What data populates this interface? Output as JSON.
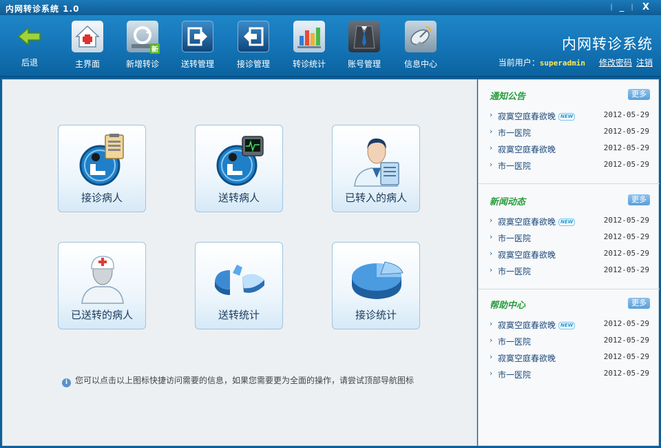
{
  "window": {
    "title": "内网转诊系统 1.0",
    "min": "_",
    "close": "X"
  },
  "nav": {
    "back": "后退",
    "items": [
      {
        "label": "主界面",
        "icon": "home-icon"
      },
      {
        "label": "新增转诊",
        "icon": "refresh-new-icon",
        "badge": "新"
      },
      {
        "label": "送转管理",
        "icon": "arrow-out-icon"
      },
      {
        "label": "接诊管理",
        "icon": "arrow-in-icon"
      },
      {
        "label": "转诊统计",
        "icon": "bar-chart-icon"
      },
      {
        "label": "账号管理",
        "icon": "suit-icon"
      },
      {
        "label": "信息中心",
        "icon": "satellite-dish-icon"
      }
    ]
  },
  "header": {
    "app_title": "内网转诊系统",
    "current_user_label": "当前用户：",
    "username": "superadmin",
    "change_password": "修改密码",
    "logout": "注销"
  },
  "tiles": [
    {
      "label": "接诊病人"
    },
    {
      "label": "送转病人"
    },
    {
      "label": "已转入的病人"
    },
    {
      "label": "已送转的病人"
    },
    {
      "label": "送转统计"
    },
    {
      "label": "接诊统计"
    }
  ],
  "tip": {
    "icon": "i",
    "text": "您可以点击以上图标快捷访问需要的信息，如果您需要更为全面的操作，请尝试顶部导航图标"
  },
  "sidebar": {
    "sections": [
      {
        "title": "通知公告",
        "more": "更多",
        "items": [
          {
            "text": "寂寞空庭春欲晚",
            "new": "NEW",
            "date": "2012-05-29"
          },
          {
            "text": "市一医院",
            "date": "2012-05-29"
          },
          {
            "text": "寂寞空庭春欲晚",
            "date": "2012-05-29"
          },
          {
            "text": "市一医院",
            "date": "2012-05-29"
          }
        ]
      },
      {
        "title": "新闻动态",
        "more": "更多",
        "items": [
          {
            "text": "寂寞空庭春欲晚",
            "new": "NEW",
            "date": "2012-05-29"
          },
          {
            "text": "市一医院",
            "date": "2012-05-29"
          },
          {
            "text": "寂寞空庭春欲晚",
            "date": "2012-05-29"
          },
          {
            "text": "市一医院",
            "date": "2012-05-29"
          }
        ]
      },
      {
        "title": "帮助中心",
        "more": "更多",
        "items": [
          {
            "text": "寂寞空庭春欲晚",
            "new": "NEW",
            "date": "2012-05-29"
          },
          {
            "text": "市一医院",
            "date": "2012-05-29"
          },
          {
            "text": "寂寞空庭春欲晚",
            "date": "2012-05-29"
          },
          {
            "text": "市一医院",
            "date": "2012-05-29"
          }
        ]
      }
    ]
  },
  "colors": {
    "header_top": "#1e86c8",
    "header_bottom": "#0b63a0",
    "section_title": "#2a9d3f",
    "username": "#ffe95a"
  }
}
